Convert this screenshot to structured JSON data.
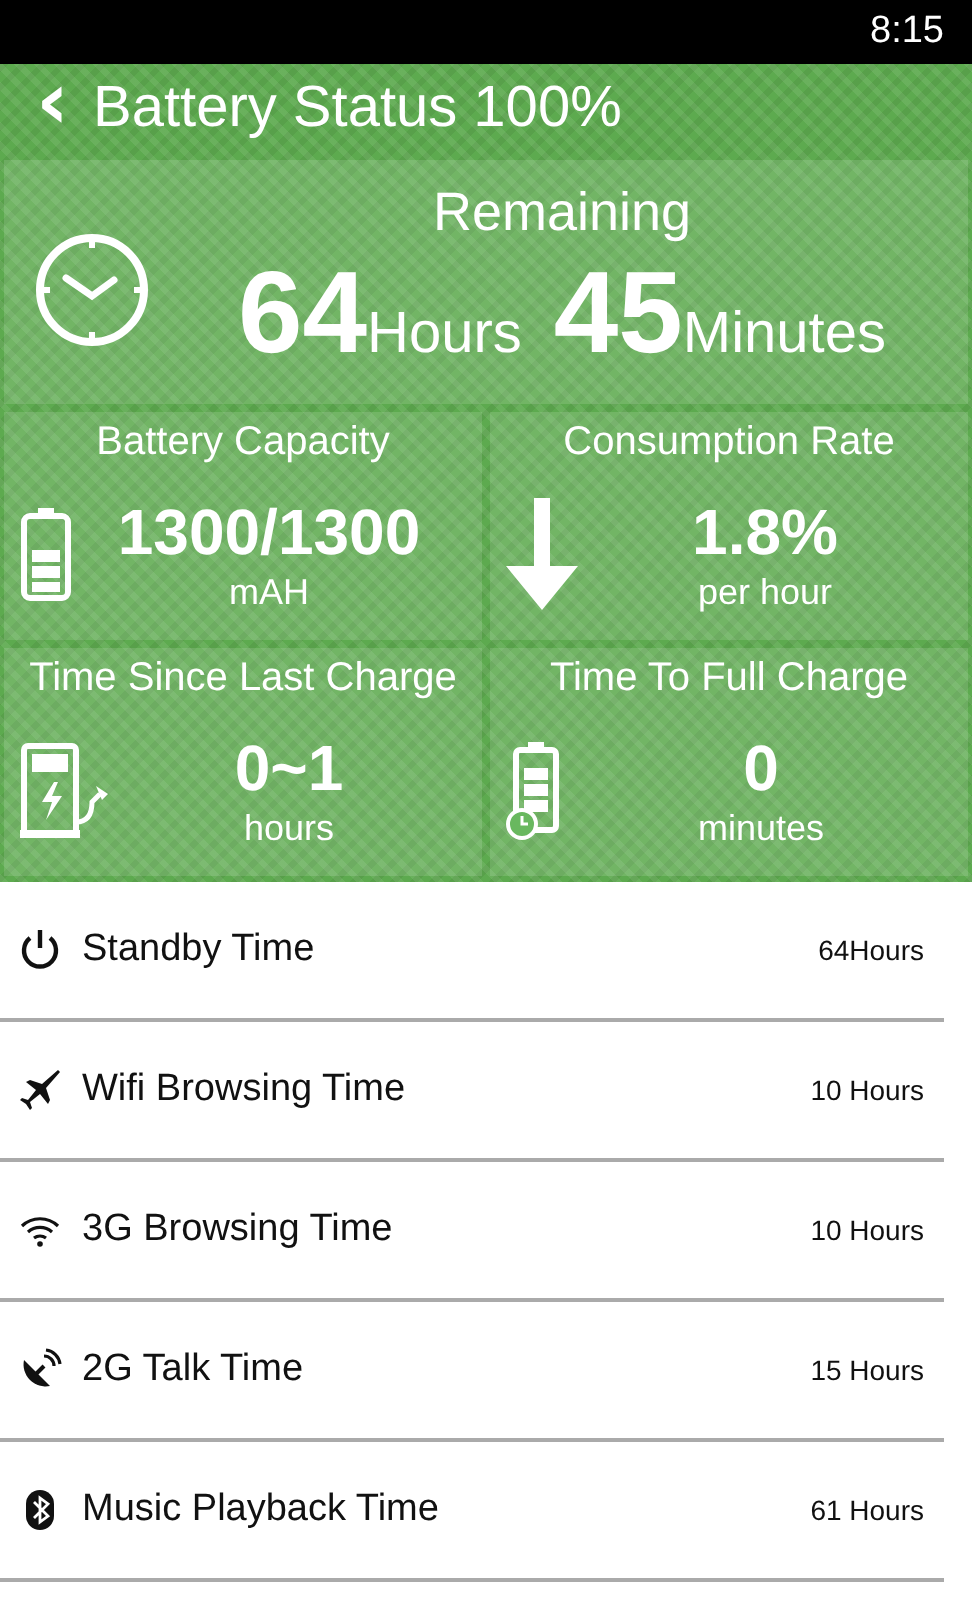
{
  "status_bar": {
    "time": "8:15"
  },
  "header": {
    "back": "‹",
    "title": "Battery Status 100%"
  },
  "remaining": {
    "label": "Remaining",
    "hours": "64",
    "hours_unit": "Hours",
    "minutes": "45",
    "minutes_unit": "Minutes"
  },
  "tiles": [
    {
      "kind": "battery",
      "title": "Battery Capacity",
      "value": "1300/1300",
      "unit": "mAH"
    },
    {
      "kind": "down",
      "title": "Consumption Rate",
      "value": "1.8%",
      "unit": "per hour"
    },
    {
      "kind": "charger",
      "title": "Time Since Last Charge",
      "value": "0~1",
      "unit": "hours"
    },
    {
      "kind": "timer",
      "title": "Time To Full Charge",
      "value": "0",
      "unit": "minutes"
    }
  ],
  "rows": [
    {
      "kind": "power",
      "label": "Standby Time",
      "value": "64Hours"
    },
    {
      "kind": "airplane",
      "label": "Wifi Browsing Time",
      "value": "10 Hours"
    },
    {
      "kind": "wifi",
      "label": "3G Browsing Time",
      "value": "10 Hours"
    },
    {
      "kind": "satellite",
      "label": "2G Talk Time",
      "value": "15 Hours"
    },
    {
      "kind": "bluetooth",
      "label": "Music Playback Time",
      "value": "61 Hours"
    }
  ]
}
